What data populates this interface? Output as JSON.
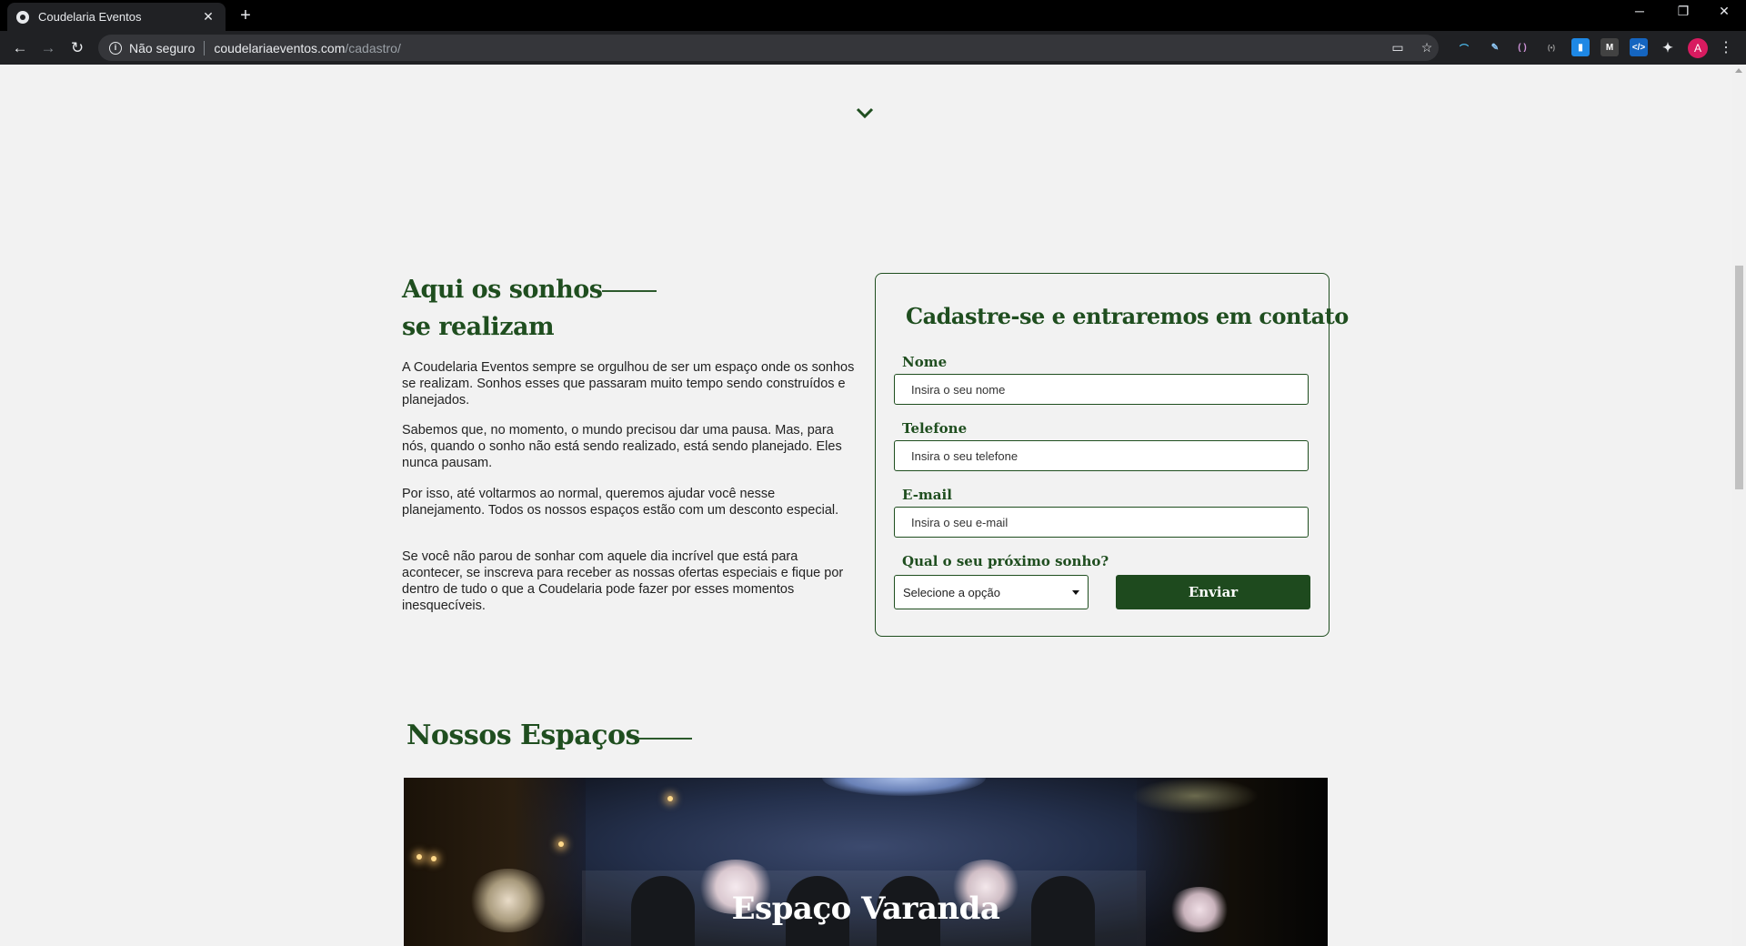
{
  "browser": {
    "tab_title": "Coudelaria Eventos",
    "new_tab": "+",
    "security_label": "Não seguro",
    "url_host": "coudelariaeventos.com",
    "url_path": "/cadastro/",
    "profile_initial": "A"
  },
  "hero": {
    "title_line1": "Aqui os sonhos",
    "title_line2": "se realizam",
    "paragraphs": [
      "A Coudelaria Eventos sempre se orgulhou de ser um espaço onde os sonhos se realizam. Sonhos esses que passaram muito tempo sendo construídos e planejados.",
      "Sabemos que, no momento, o mundo precisou dar uma pausa. Mas, para nós, quando o sonho não está sendo realizado, está sendo planejado. Eles nunca pausam.",
      "Por isso, até voltarmos ao normal, queremos ajudar você nesse planejamento. Todos os nossos espaços estão com um desconto especial.",
      "Se você não parou de sonhar com aquele dia incrível que está para acontecer, se inscreva para receber as nossas ofertas especiais e fique por dentro de tudo o que a Coudelaria pode fazer por esses momentos inesquecíveis."
    ]
  },
  "form": {
    "title": "Cadastre-se e entraremos em contato",
    "name_label": "Nome",
    "name_placeholder": "Insira o seu nome",
    "phone_label": "Telefone",
    "phone_placeholder": "Insira o seu telefone",
    "email_label": "E-mail",
    "email_placeholder": "Insira o seu e-mail",
    "dream_label": "Qual o seu próximo sonho?",
    "dream_selected": "Selecione a opção",
    "submit_label": "Enviar"
  },
  "spaces": {
    "title": "Nossos Espaços",
    "first_space_name": "Espaço Varanda"
  },
  "colors": {
    "brand_green": "#1f4e1f",
    "page_bg": "#f2f2f2"
  }
}
